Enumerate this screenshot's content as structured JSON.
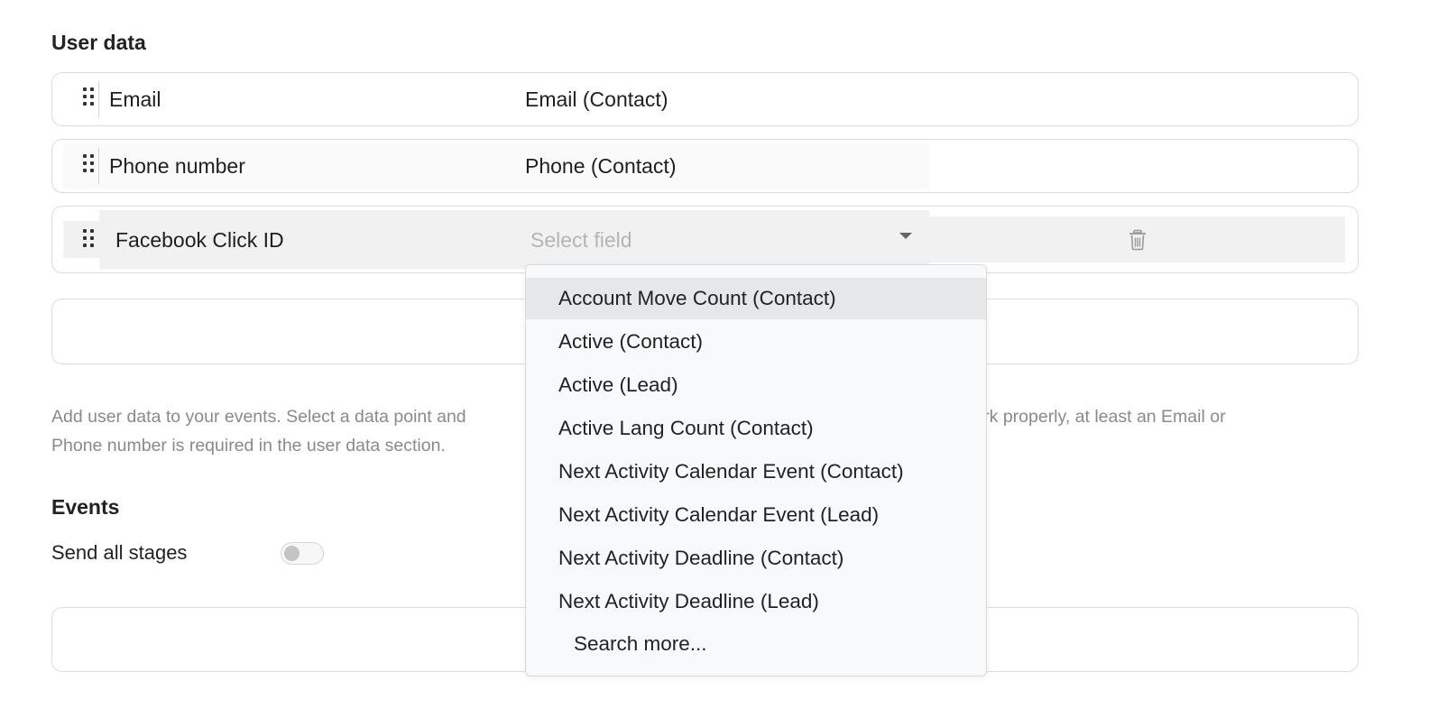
{
  "user_data": {
    "title": "User data",
    "rows": [
      {
        "label": "Email",
        "field": "Email (Contact)"
      },
      {
        "label": "Phone number",
        "field": "Phone (Contact)"
      },
      {
        "label": "Facebook Click ID",
        "field_placeholder": "Select field"
      }
    ],
    "help_text_start": "Add user data to your events. Select a data point and",
    "help_text_end": "ts work properly, at least an Email or",
    "help_text_line2": "Phone number is required in the user data section."
  },
  "events": {
    "title": "Events",
    "send_all_stages_label": "Send all stages",
    "send_all_stages_on": false
  },
  "dropdown": {
    "options": [
      "Account Move Count (Contact)",
      "Active (Contact)",
      "Active (Lead)",
      "Active Lang Count (Contact)",
      "Next Activity Calendar Event (Contact)",
      "Next Activity Calendar Event (Lead)",
      "Next Activity Deadline (Contact)",
      "Next Activity Deadline (Lead)"
    ],
    "search_more": "Search more...",
    "highlighted_index": 0
  },
  "icons": {
    "drag": "drag-handle-icon",
    "caret": "caret-down-icon",
    "trash": "trash-icon"
  }
}
